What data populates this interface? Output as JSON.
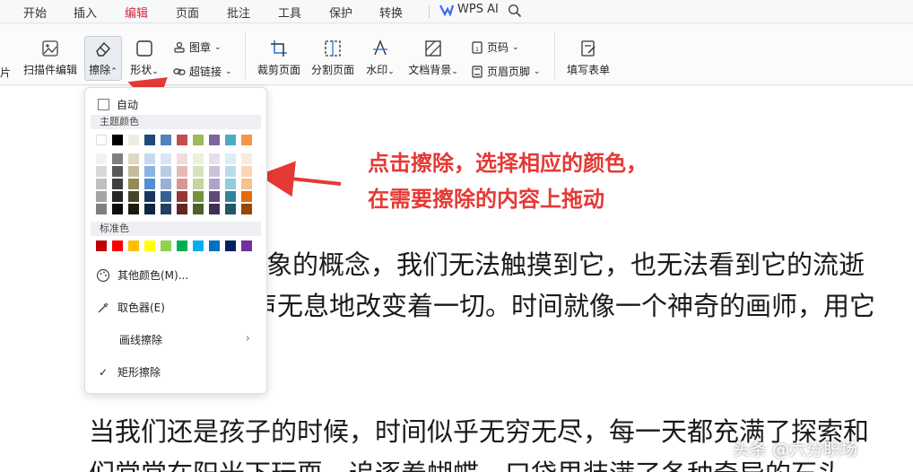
{
  "menubar": {
    "items": [
      "开始",
      "插入",
      "编辑",
      "页面",
      "批注",
      "工具",
      "保护",
      "转换"
    ],
    "active_index": 2,
    "wps_ai": "WPS AI"
  },
  "ribbon": {
    "left_partial": "片",
    "scan_edit": "扫描件编辑",
    "erase": "擦除",
    "shape": "形状",
    "stamp": "图章",
    "hyperlink": "超链接",
    "crop_page": "裁剪页面",
    "split_page": "分割页面",
    "watermark": "水印",
    "doc_background": "文档背景",
    "page_number": "页码",
    "header_footer": "页眉页脚",
    "fill_form": "填写表单"
  },
  "dropdown": {
    "auto_label": "自动",
    "theme_colors_label": "主题颜色",
    "standard_colors_label": "标准色",
    "more_colors": "其他颜色(M)...",
    "eyedropper": "取色器(E)",
    "line_erase": "画线擦除",
    "rect_erase": "矩形擦除",
    "theme_top_row": [
      "#ffffff",
      "#000000",
      "#eeece1",
      "#1f497d",
      "#4f81bd",
      "#c0504d",
      "#9bbb59",
      "#8064a2",
      "#4bacc6",
      "#f79646"
    ],
    "theme_shades": [
      [
        "#f2f2f2",
        "#7f7f7f",
        "#ddd9c3",
        "#c6d9f0",
        "#dbe5f1",
        "#f2dcdb",
        "#ebf1dd",
        "#e5e0ec",
        "#dbeef3",
        "#fdeada"
      ],
      [
        "#d8d8d8",
        "#595959",
        "#c4bd97",
        "#8db3e2",
        "#b8cce4",
        "#e5b9b7",
        "#d7e3bc",
        "#ccc1d9",
        "#b7dde8",
        "#fbd5b5"
      ],
      [
        "#bfbfbf",
        "#3f3f3f",
        "#938953",
        "#548dd4",
        "#95b3d7",
        "#d99694",
        "#c3d69b",
        "#b2a2c7",
        "#92cddc",
        "#fac08f"
      ],
      [
        "#a5a5a5",
        "#262626",
        "#494429",
        "#17365d",
        "#366092",
        "#953734",
        "#76923c",
        "#5f497a",
        "#31859b",
        "#e36c09"
      ],
      [
        "#7f7f7f",
        "#0c0c0c",
        "#1d1b10",
        "#0f243e",
        "#244061",
        "#632423",
        "#4f6128",
        "#3f3151",
        "#205867",
        "#974806"
      ]
    ],
    "standard_colors": [
      "#c00000",
      "#ff0000",
      "#ffc000",
      "#ffff00",
      "#92d050",
      "#00b050",
      "#00b0f0",
      "#0070c0",
      "#002060",
      "#7030a0"
    ]
  },
  "annotation": {
    "line1": "点击擦除，选择相应的颜色，",
    "line2": "在需要擦除的内容上拖动"
  },
  "document": {
    "line1": "抽象的概念，我们无法触摸到它，也无法看到它的流逝",
    "line2": "声无息地改变着一切。时间就像一个神奇的画师，用它",
    "line3": "当我们还是孩子的时候，时间似乎无穷无尽，每一天都充满了探索和",
    "line4": "们常常在阳光下玩耍，追逐着蝴蝶，口袋里装满了各种奇异的石头"
  },
  "watermark": "头条 @六分职场",
  "colors": {
    "accent": "#d7263d",
    "annotation": "#e53935"
  }
}
